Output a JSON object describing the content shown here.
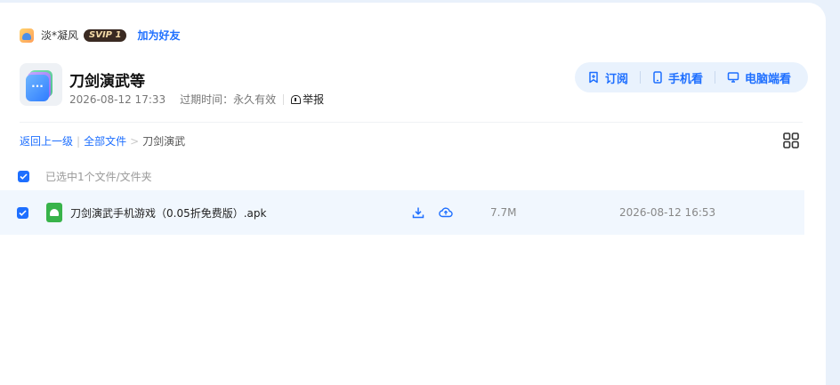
{
  "sharer": {
    "name": "淡*凝风",
    "vip_badge": "SVIP 1",
    "add_friend": "加为好友"
  },
  "file_header": {
    "title": "刀剑演武等",
    "created": "2026-08-12 17:33",
    "expire_label": "过期时间：永久有效",
    "report": "举报"
  },
  "actions": {
    "subscribe": "订阅",
    "phone": "手机看",
    "pc": "电脑端看"
  },
  "breadcrumb": {
    "back": "返回上一级",
    "all_files": "全部文件",
    "separator": ">",
    "current": "刀剑演武"
  },
  "selection": {
    "text": "已选中1个文件/文件夹"
  },
  "files": [
    {
      "name": "刀剑演武手机游戏（0.05折免费版）.apk",
      "size": "7.7M",
      "date": "2026-08-12 16:53",
      "checked": true
    }
  ],
  "colors": {
    "accent": "#1e6fff",
    "row_highlight": "#f1f7fe",
    "action_pill": "#e9f2fd",
    "apk_green": "#38b34a"
  }
}
